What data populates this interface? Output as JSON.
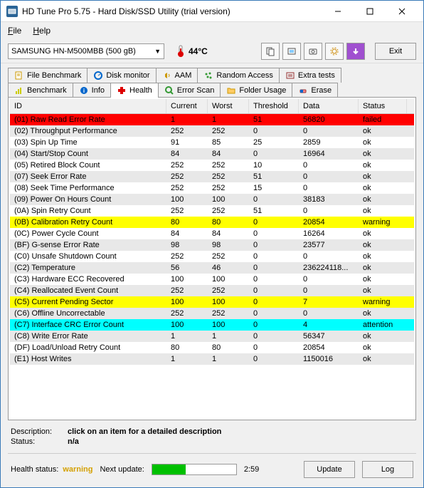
{
  "title": "HD Tune Pro 5.75 - Hard Disk/SSD Utility (trial version)",
  "menu": {
    "file": "File",
    "help": "Help"
  },
  "device": "SAMSUNG HN-M500MBB (500 gB)",
  "temperature": "44°C",
  "exit_label": "Exit",
  "tabs_row1": [
    {
      "label": "File Benchmark"
    },
    {
      "label": "Disk monitor"
    },
    {
      "label": "AAM"
    },
    {
      "label": "Random Access"
    },
    {
      "label": "Extra tests"
    }
  ],
  "tabs_row2": [
    {
      "label": "Benchmark"
    },
    {
      "label": "Info"
    },
    {
      "label": "Health"
    },
    {
      "label": "Error Scan"
    },
    {
      "label": "Folder Usage"
    },
    {
      "label": "Erase"
    }
  ],
  "columns": {
    "id": "ID",
    "current": "Current",
    "worst": "Worst",
    "threshold": "Threshold",
    "data": "Data",
    "status": "Status"
  },
  "rows": [
    {
      "id": "(01) Raw Read Error Rate",
      "cur": "1",
      "worst": "1",
      "thr": "51",
      "data": "56820",
      "status": "failed",
      "hl": "red"
    },
    {
      "id": "(02) Throughput Performance",
      "cur": "252",
      "worst": "252",
      "thr": "0",
      "data": "0",
      "status": "ok"
    },
    {
      "id": "(03) Spin Up Time",
      "cur": "91",
      "worst": "85",
      "thr": "25",
      "data": "2859",
      "status": "ok"
    },
    {
      "id": "(04) Start/Stop Count",
      "cur": "84",
      "worst": "84",
      "thr": "0",
      "data": "16964",
      "status": "ok"
    },
    {
      "id": "(05) Retired Block Count",
      "cur": "252",
      "worst": "252",
      "thr": "10",
      "data": "0",
      "status": "ok"
    },
    {
      "id": "(07) Seek Error Rate",
      "cur": "252",
      "worst": "252",
      "thr": "51",
      "data": "0",
      "status": "ok"
    },
    {
      "id": "(08) Seek Time Performance",
      "cur": "252",
      "worst": "252",
      "thr": "15",
      "data": "0",
      "status": "ok"
    },
    {
      "id": "(09) Power On Hours Count",
      "cur": "100",
      "worst": "100",
      "thr": "0",
      "data": "38183",
      "status": "ok"
    },
    {
      "id": "(0A) Spin Retry Count",
      "cur": "252",
      "worst": "252",
      "thr": "51",
      "data": "0",
      "status": "ok"
    },
    {
      "id": "(0B) Calibration Retry Count",
      "cur": "80",
      "worst": "80",
      "thr": "0",
      "data": "20854",
      "status": "warning",
      "hl": "yellow"
    },
    {
      "id": "(0C) Power Cycle Count",
      "cur": "84",
      "worst": "84",
      "thr": "0",
      "data": "16264",
      "status": "ok"
    },
    {
      "id": "(BF) G-sense Error Rate",
      "cur": "98",
      "worst": "98",
      "thr": "0",
      "data": "23577",
      "status": "ok"
    },
    {
      "id": "(C0) Unsafe Shutdown Count",
      "cur": "252",
      "worst": "252",
      "thr": "0",
      "data": "0",
      "status": "ok"
    },
    {
      "id": "(C2) Temperature",
      "cur": "56",
      "worst": "46",
      "thr": "0",
      "data": "236224118...",
      "status": "ok"
    },
    {
      "id": "(C3) Hardware ECC Recovered",
      "cur": "100",
      "worst": "100",
      "thr": "0",
      "data": "0",
      "status": "ok"
    },
    {
      "id": "(C4) Reallocated Event Count",
      "cur": "252",
      "worst": "252",
      "thr": "0",
      "data": "0",
      "status": "ok"
    },
    {
      "id": "(C5) Current Pending Sector",
      "cur": "100",
      "worst": "100",
      "thr": "0",
      "data": "7",
      "status": "warning",
      "hl": "yellow"
    },
    {
      "id": "(C6) Offline Uncorrectable",
      "cur": "252",
      "worst": "252",
      "thr": "0",
      "data": "0",
      "status": "ok"
    },
    {
      "id": "(C7) Interface CRC Error Count",
      "cur": "100",
      "worst": "100",
      "thr": "0",
      "data": "4",
      "status": "attention",
      "hl": "cyan"
    },
    {
      "id": "(C8) Write Error Rate",
      "cur": "1",
      "worst": "1",
      "thr": "0",
      "data": "56347",
      "status": "ok"
    },
    {
      "id": "(DF) Load/Unload Retry Count",
      "cur": "80",
      "worst": "80",
      "thr": "0",
      "data": "20854",
      "status": "ok"
    },
    {
      "id": "(E1) Host Writes",
      "cur": "1",
      "worst": "1",
      "thr": "0",
      "data": "1150016",
      "status": "ok"
    }
  ],
  "desc": {
    "desc_label": "Description:",
    "desc_value": "click on an item for a detailed description",
    "status_label": "Status:",
    "status_value": "n/a"
  },
  "bottom": {
    "health_label": "Health status:",
    "health_value": "warning",
    "next_update_label": "Next update:",
    "timer": "2:59",
    "update_btn": "Update",
    "log_btn": "Log"
  }
}
